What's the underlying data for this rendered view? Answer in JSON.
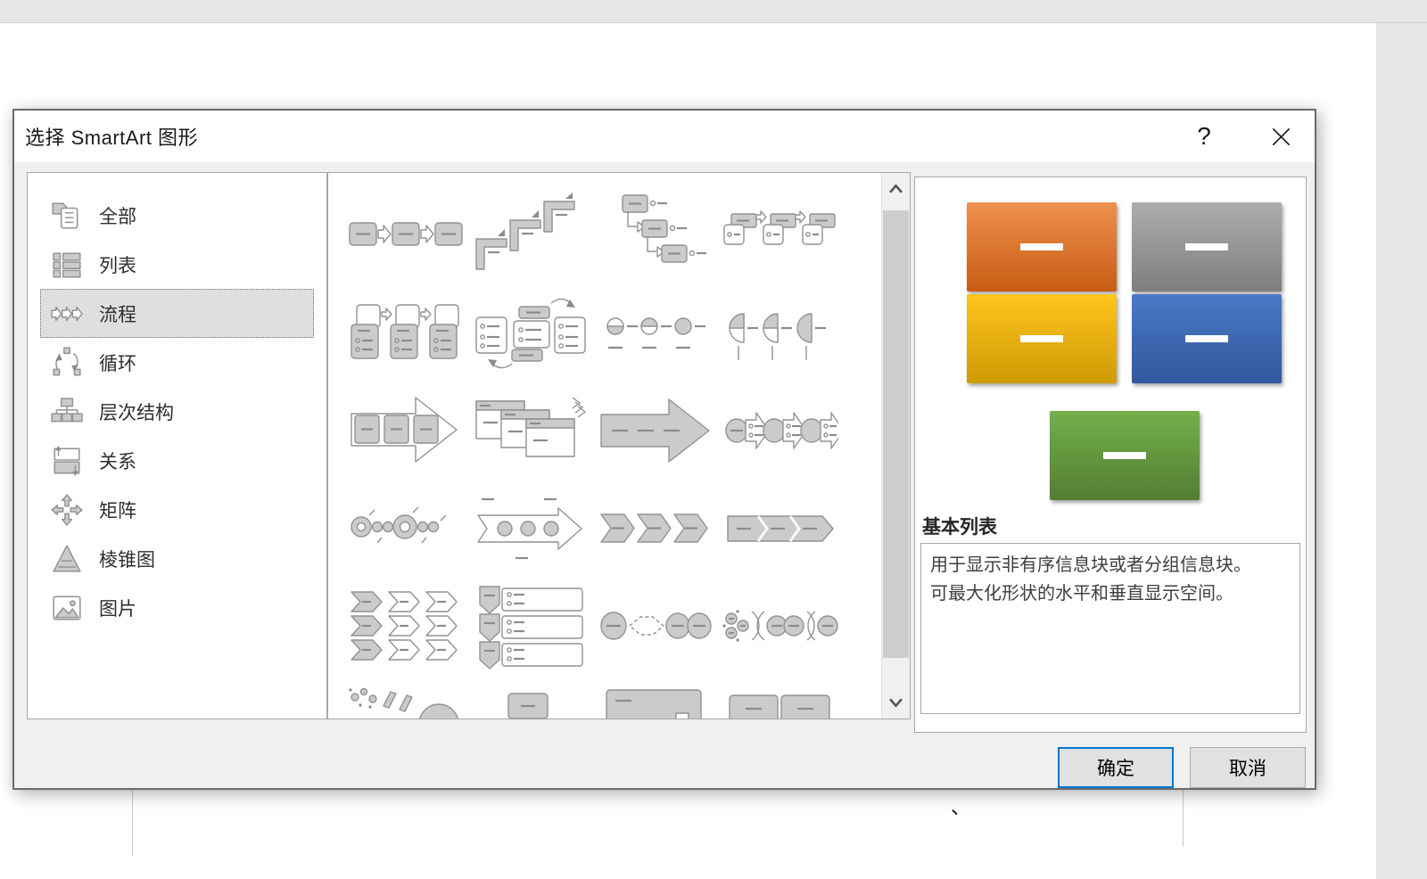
{
  "window": {
    "title": "选择 SmartArt 图形",
    "help_label": "?",
    "close_icon": "close-x"
  },
  "categories": {
    "items": [
      {
        "key": "all",
        "label": "全部",
        "icon": "all-icon",
        "selected": false
      },
      {
        "key": "list",
        "label": "列表",
        "icon": "list-icon",
        "selected": false
      },
      {
        "key": "process",
        "label": "流程",
        "icon": "process-icon",
        "selected": true
      },
      {
        "key": "cycle",
        "label": "循环",
        "icon": "cycle-icon",
        "selected": false
      },
      {
        "key": "hierarchy",
        "label": "层次结构",
        "icon": "hierarchy-icon",
        "selected": false
      },
      {
        "key": "relationship",
        "label": "关系",
        "icon": "relationship-icon",
        "selected": false
      },
      {
        "key": "matrix",
        "label": "矩阵",
        "icon": "matrix-icon",
        "selected": false
      },
      {
        "key": "pyramid",
        "label": "棱锥图",
        "icon": "pyramid-icon",
        "selected": false
      },
      {
        "key": "picture",
        "label": "图片",
        "icon": "picture-icon",
        "selected": false
      }
    ]
  },
  "gallery": {
    "scrollbar": {
      "up_icon": "chevron-up-icon",
      "down_icon": "chevron-down-icon"
    },
    "items": [
      "basic-process",
      "step-up-process",
      "step-down-process",
      "accent-process",
      "alternating-flow",
      "detailed-process",
      "circle-bending-process",
      "half-circle-process",
      "arrow-ribbon-process",
      "process-list",
      "basic-arrow-process",
      "circle-arrow-process",
      "ring-process",
      "circles-in-arrow-process",
      "chevron-accent-process",
      "closed-chevron-process",
      "multi-chevron-list",
      "vertical-arrow-list",
      "linked-circles-process",
      "grouped-circle-process",
      "funnel-process",
      "monitor-block-process",
      "wide-block-process",
      "paired-block-process"
    ]
  },
  "preview": {
    "name": "基本列表",
    "description_lines": [
      "用于显示非有序信息块或者分组信息块。",
      "可最大化形状的水平和垂直显示空间。"
    ],
    "dash_color": "#FFFFFF",
    "shapes": [
      {
        "name": "orange-block",
        "top": "#F0914F",
        "bottom": "#C75C12"
      },
      {
        "name": "gray-block",
        "top": "#AEAEAE",
        "bottom": "#7E7E7E"
      },
      {
        "name": "yellow-block",
        "top": "#FFC41E",
        "bottom": "#CE9B04"
      },
      {
        "name": "blue-block",
        "top": "#4C79C5",
        "bottom": "#2F589E"
      },
      {
        "name": "green-block",
        "top": "#74AF4B",
        "bottom": "#527F33"
      }
    ]
  },
  "buttons": {
    "ok": "确定",
    "cancel": "取消"
  },
  "background": {
    "mark": "、"
  }
}
